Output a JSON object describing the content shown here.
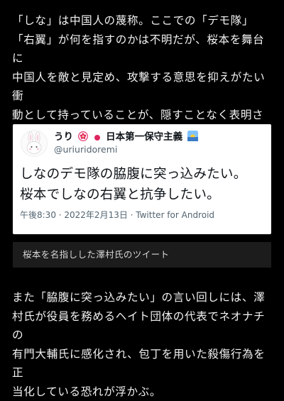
{
  "article": {
    "paragraph_1": "「しな」は中国人の蔑称。ここでの「デモ隊」\n「右翼」が何を指すのかは不明だが、桜本を舞台に\n中国人を敵と見定め、攻撃する意思を抑えがたい衝\n動として持っていることが、隠すことなく表明され\nている。",
    "paragraph_2": "また「脇腹に突っ込みたい」の言い回しには、澤\n村氏が役員を務めるヘイト団体の代表でネオナチの\n有門大輔氏に感化され、包丁を用いた殺傷行為を正\n当化している恐れが浮かぶ。"
  },
  "tweet": {
    "display_name_prefix": "うり",
    "display_name_suffix": "日本第一保守主義",
    "handle": "@uriuridoremi",
    "text": "しなのデモ隊の脇腹に突っ込みたい。\n桜本でしなの右翼と抗争したい。",
    "timestamp": "午後8:30 · 2022年2月13日 · Twitter for Android"
  },
  "caption": {
    "text": "桜本を名指しした澤村氏のツイート"
  },
  "icons": {
    "name_icons": [
      "sakura-badge-icon",
      "japan-flag-icon",
      "sunrise-emoji-icon"
    ],
    "avatar": "bunny-avatar-icon"
  },
  "colors": {
    "background": "#000000",
    "card": "#ffffff",
    "caption_box": "#1c1c1c",
    "tweet_text": "#0f1419",
    "tweet_meta": "#536471"
  }
}
